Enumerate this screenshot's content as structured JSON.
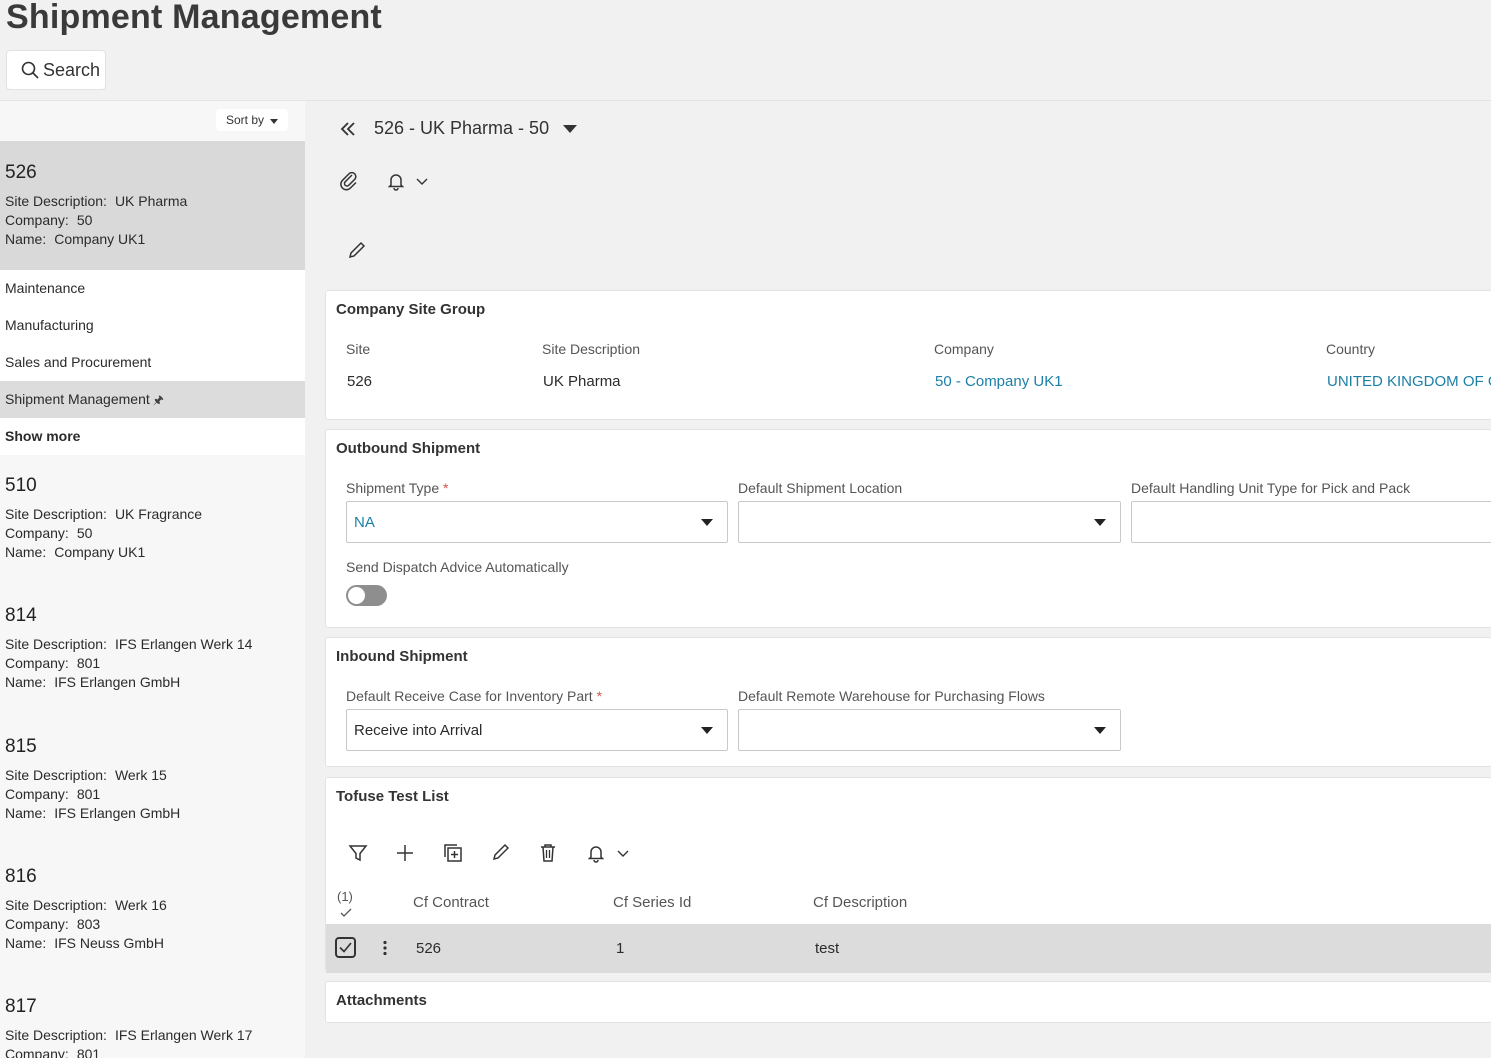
{
  "page": {
    "title": "Shipment Management",
    "search_label": "Search"
  },
  "list": {
    "sort_label": "Sort by",
    "selected": {
      "number": "526",
      "site_description_label": "Site Description:",
      "site_description": "UK Pharma",
      "company_label": "Company:",
      "company": "50",
      "name_label": "Name:",
      "name": "Company UK1"
    },
    "nav": [
      {
        "label": "Maintenance"
      },
      {
        "label": "Manufacturing"
      },
      {
        "label": "Sales and Procurement"
      },
      {
        "label": "Shipment Management"
      },
      {
        "label": "Show more"
      }
    ],
    "items": [
      {
        "number": "510",
        "site_description": "UK Fragrance",
        "company": "50",
        "name": "Company UK1"
      },
      {
        "number": "814",
        "site_description": "IFS Erlangen Werk 14",
        "company": "801",
        "name": "IFS Erlangen GmbH"
      },
      {
        "number": "815",
        "site_description": "Werk 15",
        "company": "801",
        "name": "IFS Erlangen GmbH"
      },
      {
        "number": "816",
        "site_description": "Werk 16",
        "company": "803",
        "name": "IFS Neuss GmbH"
      },
      {
        "number": "817",
        "site_description": "IFS Erlangen Werk 17",
        "company": "801",
        "name": ""
      }
    ],
    "labels": {
      "site_description": "Site Description:",
      "company": "Company:",
      "name": "Name:"
    }
  },
  "record": {
    "title": "526 - UK Pharma - 50"
  },
  "company_site_group": {
    "title": "Company Site Group",
    "site_label": "Site",
    "site": "526",
    "site_description_label": "Site Description",
    "site_description": "UK Pharma",
    "company_label": "Company",
    "company": "50 - Company UK1",
    "country_label": "Country",
    "country": "UNITED KINGDOM OF GREAT BRITAIN AND NORTHERN IRELAND"
  },
  "outbound": {
    "title": "Outbound Shipment",
    "shipment_type_label": "Shipment Type",
    "required_mark": "*",
    "shipment_type": "NA",
    "default_location_label": "Default Shipment Location",
    "default_location": "",
    "handling_unit_label": "Default Handling Unit Type for Pick and Pack",
    "handling_unit": "",
    "dispatch_label": "Send Dispatch Advice Automatically",
    "dispatch_on": false
  },
  "inbound": {
    "title": "Inbound Shipment",
    "receive_case_label": "Default Receive Case for Inventory Part",
    "required_mark": "*",
    "receive_case": "Receive into Arrival",
    "remote_warehouse_label": "Default Remote Warehouse for Purchasing Flows",
    "remote_warehouse": ""
  },
  "tofuse": {
    "title": "Tofuse Test List",
    "selected_count": "(1)",
    "columns": [
      "Cf Contract",
      "Cf Series Id",
      "Cf Description"
    ],
    "rows": [
      {
        "contract": "526",
        "series_id": "1",
        "description": "test"
      }
    ]
  },
  "attachments": {
    "title": "Attachments"
  }
}
